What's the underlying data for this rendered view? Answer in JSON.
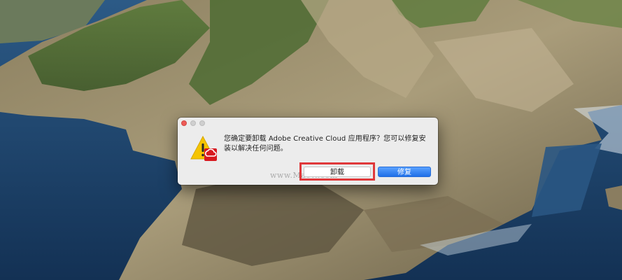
{
  "dialog": {
    "message": "您确定要卸载 Adobe Creative Cloud 应用程序？您可以修复安装以解决任何问题。",
    "watermark": "www.MacW.com",
    "uninstall_label": "卸载",
    "repair_label": "修复"
  },
  "icons": {
    "warning": "warning-triangle-icon",
    "app": "adobe-creative-cloud-icon"
  },
  "colors": {
    "primary_button": "#1f6fe8",
    "highlight_box": "#e0393b",
    "close_light": "#ee5b57"
  }
}
